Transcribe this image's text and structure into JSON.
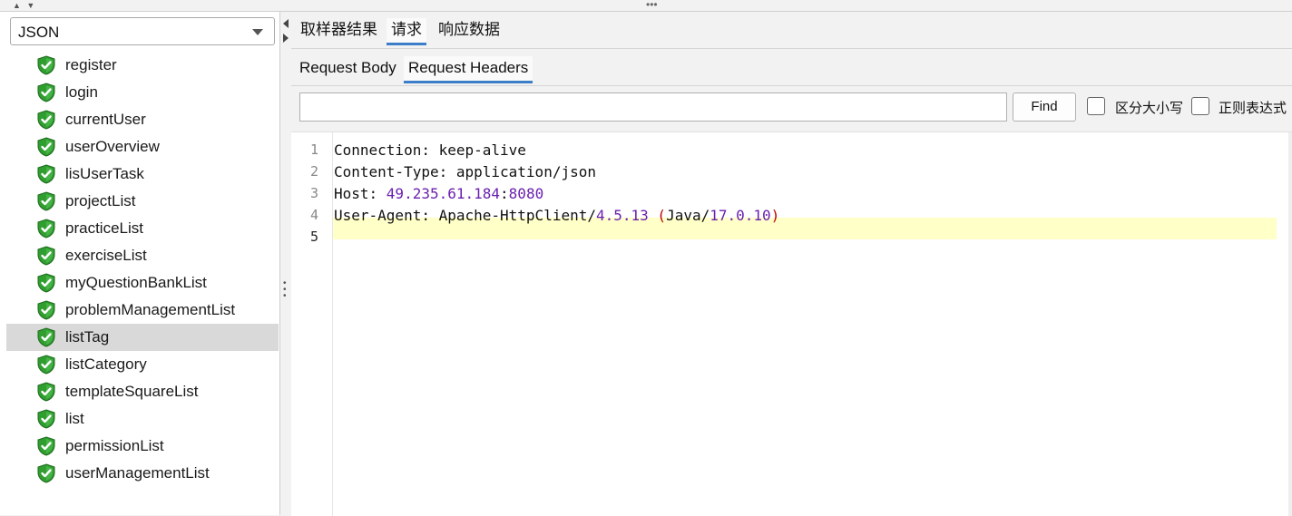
{
  "left": {
    "combo_value": "JSON",
    "items": [
      {
        "label": "register"
      },
      {
        "label": "login"
      },
      {
        "label": "currentUser"
      },
      {
        "label": "userOverview"
      },
      {
        "label": "lisUserTask"
      },
      {
        "label": "projectList"
      },
      {
        "label": "practiceList"
      },
      {
        "label": "exerciseList"
      },
      {
        "label": " myQuestionBankList"
      },
      {
        "label": "problemManagementList"
      },
      {
        "label": "listTag"
      },
      {
        "label": "listCategory"
      },
      {
        "label": "templateSquareList"
      },
      {
        "label": "list"
      },
      {
        "label": "permissionList"
      },
      {
        "label": "userManagementList"
      }
    ],
    "selected_item": "listTag",
    "icon": "shield-check-icon"
  },
  "tabs_main": [
    {
      "label": "取样器结果"
    },
    {
      "label": "请求"
    },
    {
      "label": "响应数据"
    }
  ],
  "tabs_main_active": "请求",
  "tabs_sub": [
    {
      "label": "Request Body"
    },
    {
      "label": "Request Headers"
    }
  ],
  "tabs_sub_active": "Request Headers",
  "search": {
    "value": "",
    "find_label": "Find",
    "case_label": "区分大小写",
    "regex_label": "正则表达式"
  },
  "editor": {
    "line_numbers": [
      "1",
      "2",
      "3",
      "4",
      "5"
    ],
    "current_line": "5",
    "lines": {
      "l1": {
        "key": "Connection",
        "sep": ": ",
        "val": "keep-alive"
      },
      "l2": {
        "key": "Content-Type",
        "sep": ": ",
        "val": "application/json"
      },
      "l3": {
        "key": "Host",
        "sep": ": ",
        "ip": "49.235.61.184",
        "colon": ":",
        "port": "8080"
      },
      "l4": {
        "key": "User-Agent",
        "sep": ": ",
        "a": "Apache-HttpClient/",
        "b": "4.5.13",
        "c": " ",
        "d": "(",
        "e": "Java/",
        "f": "17.0.10",
        "g": ")"
      }
    }
  },
  "colors": {
    "accent": "#3c7fc8",
    "current_line": "#ffffc8",
    "number": "#6a1fb0",
    "paren": "#c00000",
    "shield": "#2f9e2f"
  }
}
